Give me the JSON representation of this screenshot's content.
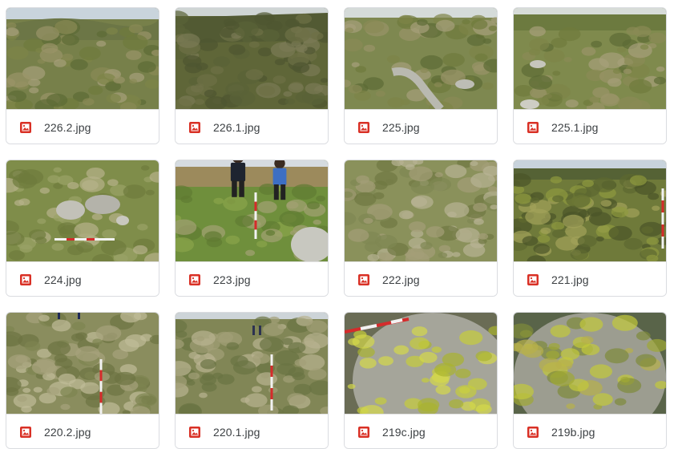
{
  "files": [
    {
      "name": "226.2.jpg",
      "scene": "moor-hill"
    },
    {
      "name": "226.1.jpg",
      "scene": "moor-dark"
    },
    {
      "name": "225.jpg",
      "scene": "moor-wall"
    },
    {
      "name": "225.1.jpg",
      "scene": "moor-wall-far"
    },
    {
      "name": "224.jpg",
      "scene": "stones-pole"
    },
    {
      "name": "223.jpg",
      "scene": "people"
    },
    {
      "name": "222.jpg",
      "scene": "grass"
    },
    {
      "name": "221.jpg",
      "scene": "mossy-pole"
    },
    {
      "name": "220.2.jpg",
      "scene": "tussock-pole"
    },
    {
      "name": "220.1.jpg",
      "scene": "tussock-people"
    },
    {
      "name": "219c.jpg",
      "scene": "lichen-rock-pole"
    },
    {
      "name": "219b.jpg",
      "scene": "lichen-rock"
    }
  ],
  "icon": {
    "name": "image-file-icon",
    "color": "#d93025"
  }
}
